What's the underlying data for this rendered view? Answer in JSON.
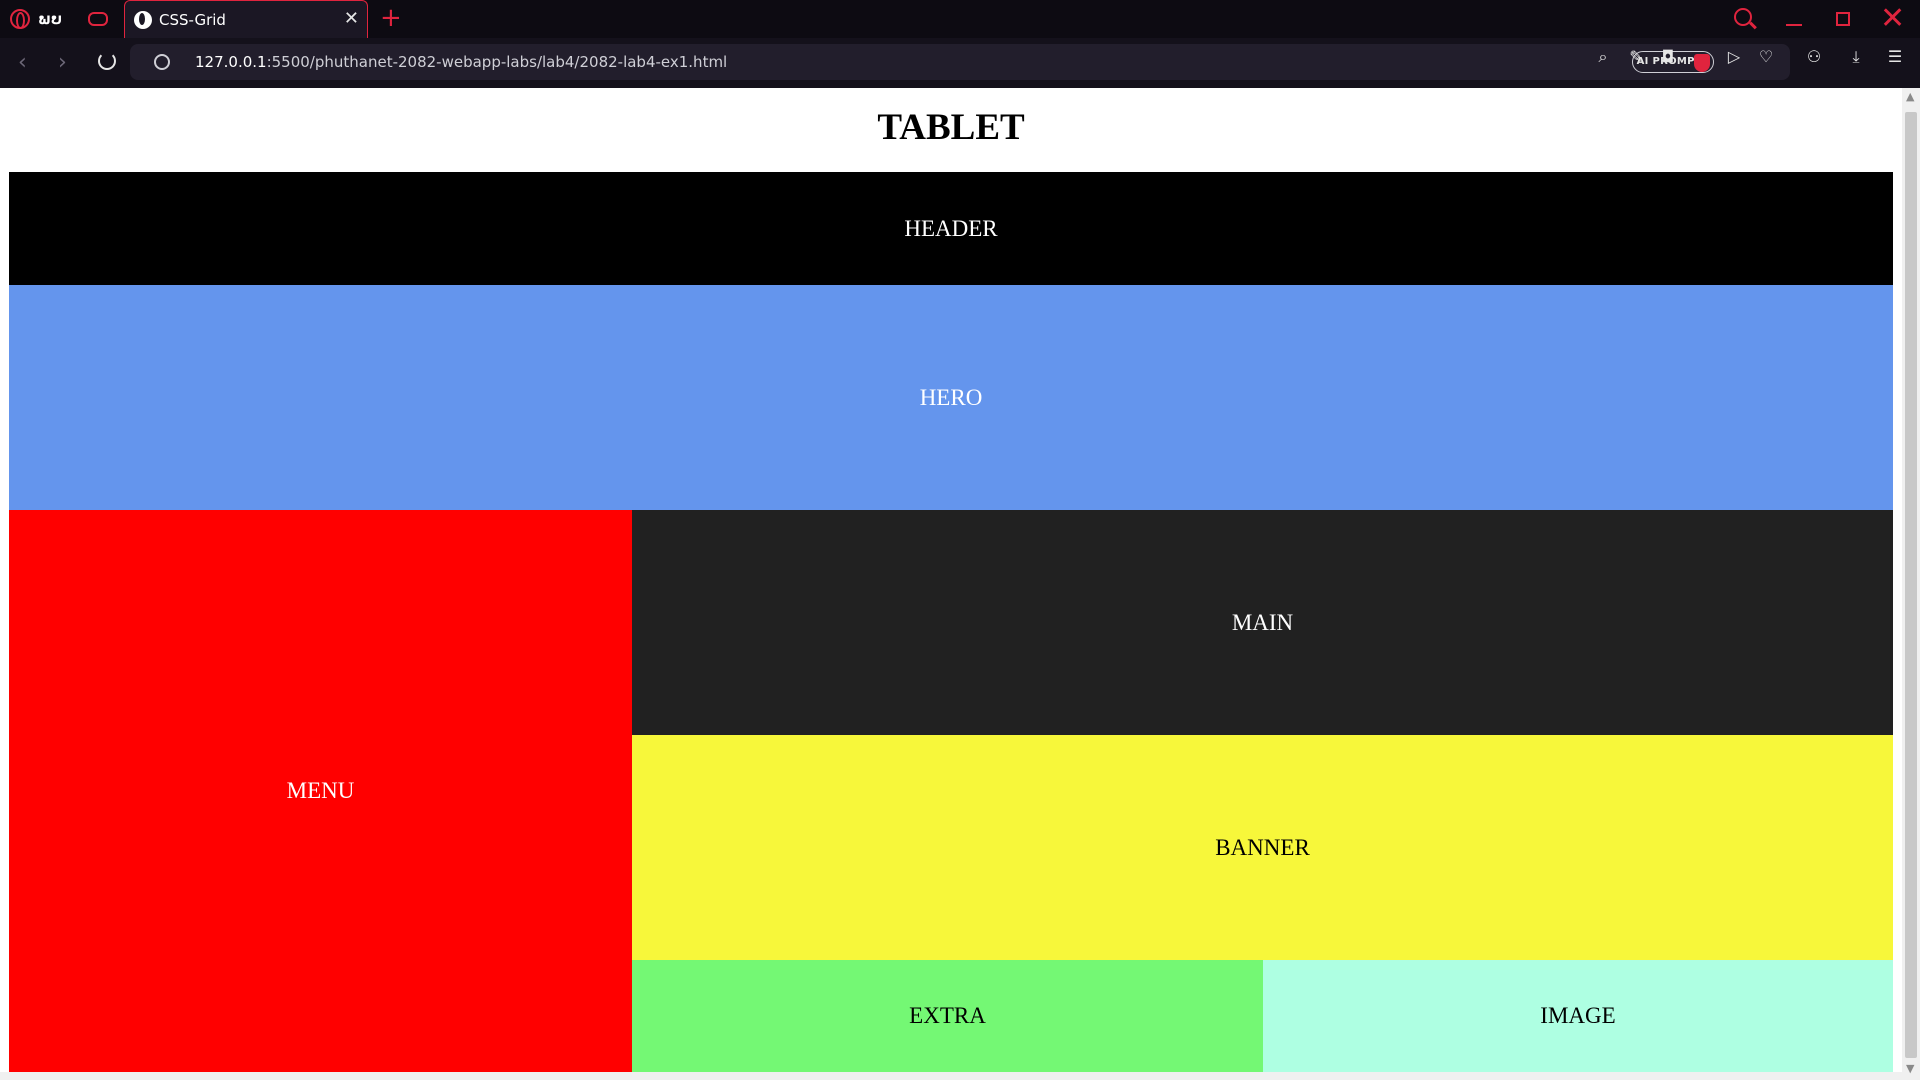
{
  "tabbar": {
    "workspace_label": "ພບ",
    "tab_title": "CSS-Grid",
    "new_tab_symbol": "+",
    "close_symbol": "✕"
  },
  "navbar": {
    "back_symbol": "‹",
    "forward_symbol": "›",
    "url_host": "127.0.0.1",
    "url_path": ":5500/phuthanet-2082-webapp-labs/lab4/2082-lab4-ex1.html",
    "ai_prompts_label": "AI PROMPTS"
  },
  "page": {
    "title": "TABLET",
    "areas": {
      "header": "HEADER",
      "hero": "HERO",
      "menu": "MENU",
      "main": "MAIN",
      "banner": "BANNER",
      "extra": "EXTRA",
      "image": "IMAGE"
    }
  },
  "colors": {
    "accent": "#e0243e",
    "header": "#000000",
    "hero": "#6495ed",
    "menu": "#ff0000",
    "main": "#212121",
    "banner": "#f7f73a",
    "extra": "#74f874",
    "image": "#aeffe2"
  }
}
